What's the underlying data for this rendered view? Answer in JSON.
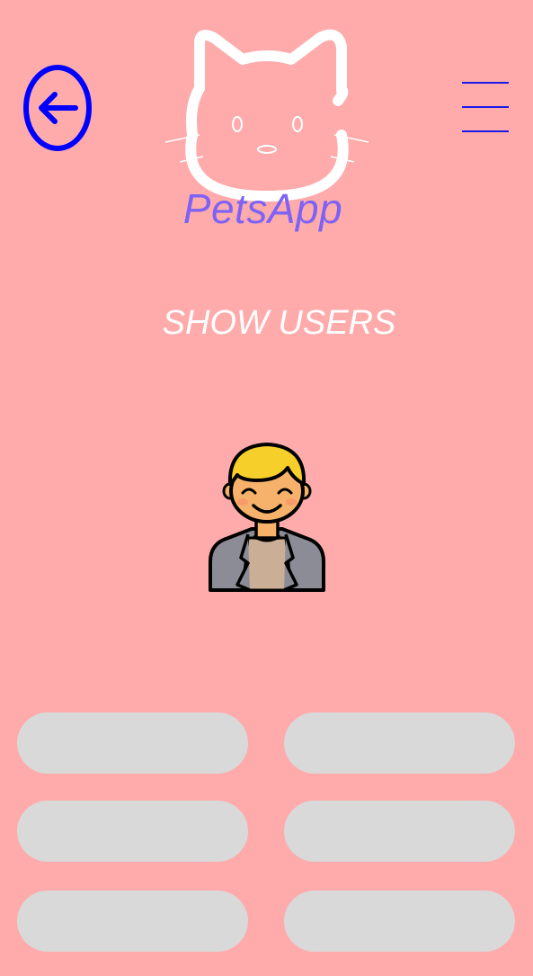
{
  "header": {
    "back_icon": "arrow-left-circle-icon",
    "logo_icon": "cat-face-icon",
    "app_name": "PetsApp",
    "menu_icon": "hamburger-menu-icon"
  },
  "main": {
    "title": "SHOW USERS",
    "avatar_icon": "user-avatar-icon"
  },
  "buttons": [
    {
      "label": ""
    },
    {
      "label": ""
    },
    {
      "label": ""
    },
    {
      "label": ""
    },
    {
      "label": ""
    },
    {
      "label": ""
    }
  ],
  "colors": {
    "background": "#FFABAB",
    "accent_blue": "#0000FF",
    "brand_purple": "#7D62F5",
    "button_gray": "#D9D9D9",
    "title_white": "#FFFFFF"
  }
}
